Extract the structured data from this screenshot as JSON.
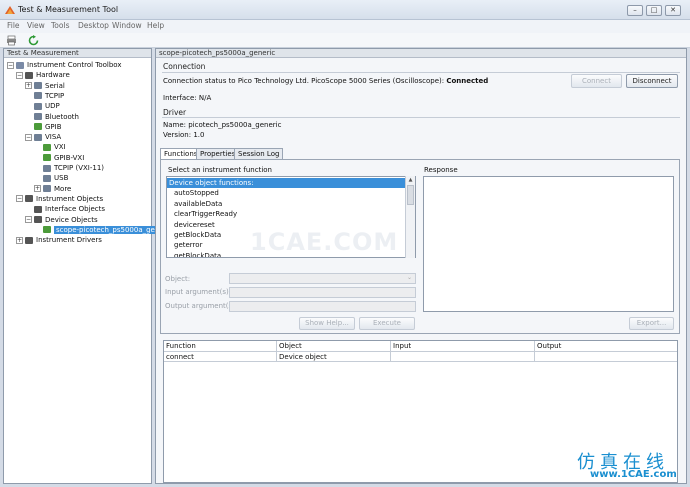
{
  "window": {
    "title": "Test & Measurement Tool"
  },
  "menu": [
    "File",
    "View",
    "Tools",
    "Desktop",
    "Window",
    "Help"
  ],
  "left_panel": {
    "header": "Test & Measurement",
    "tree": [
      {
        "label": "Instrument Control Toolbox",
        "indent": 0,
        "expander": "−",
        "icon": "toolbox-icon",
        "color": "#7a8aa6"
      },
      {
        "label": "Hardware",
        "indent": 1,
        "expander": "−",
        "icon": "hardware-icon",
        "color": "#555555"
      },
      {
        "label": "Serial",
        "indent": 2,
        "expander": "+",
        "icon": "serial-icon",
        "color": "#6f7f95"
      },
      {
        "label": "TCPIP",
        "indent": 2,
        "expander": "",
        "icon": "tcpip-icon",
        "color": "#6f7f95"
      },
      {
        "label": "UDP",
        "indent": 2,
        "expander": "",
        "icon": "udp-icon",
        "color": "#6f7f95"
      },
      {
        "label": "Bluetooth",
        "indent": 2,
        "expander": "",
        "icon": "bluetooth-icon",
        "color": "#6f7f95"
      },
      {
        "label": "GPIB",
        "indent": 2,
        "expander": "",
        "icon": "gpib-icon",
        "color": "#4c9b3a"
      },
      {
        "label": "VISA",
        "indent": 2,
        "expander": "−",
        "icon": "visa-icon",
        "color": "#6f7f95"
      },
      {
        "label": "VXI",
        "indent": 3,
        "expander": "",
        "icon": "vxi-icon",
        "color": "#4c9b3a"
      },
      {
        "label": "GPIB-VXI",
        "indent": 3,
        "expander": "",
        "icon": "gpib-vxi-icon",
        "color": "#4c9b3a"
      },
      {
        "label": "TCPIP (VXI-11)",
        "indent": 3,
        "expander": "",
        "icon": "tcpip-vxi-icon",
        "color": "#6f7f95"
      },
      {
        "label": "USB",
        "indent": 3,
        "expander": "",
        "icon": "usb-icon",
        "color": "#6f7f95"
      },
      {
        "label": "More",
        "indent": 3,
        "expander": "+",
        "icon": "more-icon",
        "color": "#6f7f95"
      },
      {
        "label": "Instrument Objects",
        "indent": 1,
        "expander": "−",
        "icon": "instrument-objects-icon",
        "color": "#555555"
      },
      {
        "label": "Interface Objects",
        "indent": 2,
        "expander": "",
        "icon": "interface-objects-icon",
        "color": "#555555"
      },
      {
        "label": "Device Objects",
        "indent": 2,
        "expander": "−",
        "icon": "device-objects-icon",
        "color": "#555555"
      },
      {
        "label": "scope-picotech_ps5000a_generic",
        "indent": 3,
        "expander": "",
        "icon": "scope-icon",
        "color": "#4c9b3a",
        "selected": true
      },
      {
        "label": "Instrument Drivers",
        "indent": 1,
        "expander": "+",
        "icon": "instrument-drivers-icon",
        "color": "#555555"
      }
    ]
  },
  "right_panel": {
    "header": "scope-picotech_ps5000a_generic",
    "connection": {
      "title": "Connection",
      "status_prefix": "Connection status to Pico Technology Ltd. PicoScope 5000 Series (Oscilloscope): ",
      "status_value": "Connected",
      "interface": "Interface: N/A",
      "connect_label": "Connect",
      "disconnect_label": "Disconnect"
    },
    "driver": {
      "title": "Driver",
      "name": "Name:  picotech_ps5000a_generic",
      "version": "Version: 1.0"
    },
    "tabs": [
      "Functions",
      "Properties",
      "Session Log"
    ],
    "functions": {
      "select_label": "Select an instrument function",
      "items": [
        "Device object functions:",
        "autoStopped",
        "availableData",
        "clearTriggerReady",
        "devicereset",
        "getBlockData",
        "geterror",
        "getBlockData"
      ],
      "response_label": "Response",
      "object_label": "Object:",
      "input_label": "Input argument(s):",
      "output_label": "Output argument(s):",
      "show_help_label": "Show Help...",
      "execute_label": "Execute",
      "export_label": "Export..."
    },
    "table": {
      "columns": [
        "Function",
        "Object",
        "Input",
        "Output"
      ],
      "rows": [
        [
          "connect",
          "Device object",
          "",
          ""
        ]
      ]
    }
  },
  "watermark": {
    "main": "1CAE.COM",
    "cn": "仿真在线",
    "en": "www.1CAE.com"
  }
}
